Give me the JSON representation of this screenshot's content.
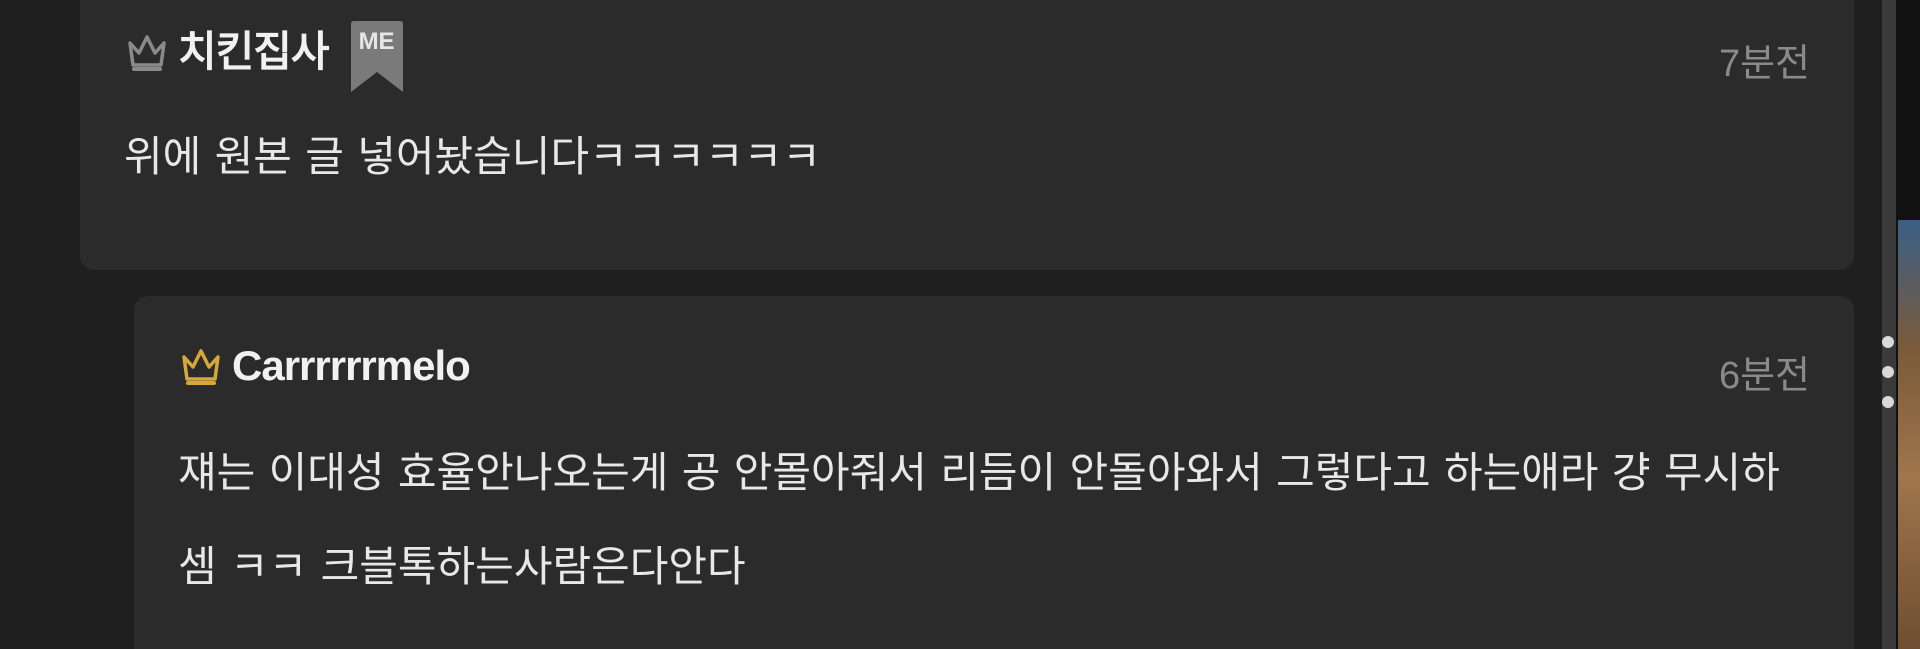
{
  "comments": [
    {
      "author": "치킨집사",
      "badge": "ME",
      "time": "7분전",
      "text": "위에 원본 글 넣어놨습니다ㅋㅋㅋㅋㅋㅋ",
      "crown_color": "#8a8a8a"
    },
    {
      "author": "Carrrrrrmelo",
      "time": "6분전",
      "text": "쟤는 이대성 효율안나오는게 공 안몰아줘서 리듬이 안돌아와서 그렇다고 하는애라 걍 무시하셈 ㅋㅋ 크블톡하는사람은다안다",
      "crown_color": "#d4a93a"
    }
  ],
  "colors": {
    "background": "#1f1f1f",
    "card": "#2b2b2b",
    "time_text": "#8a8a8a",
    "badge_bg": "#7a7a7a"
  },
  "icons": {
    "crown": "crown-icon",
    "more": "more-dots-icon"
  }
}
